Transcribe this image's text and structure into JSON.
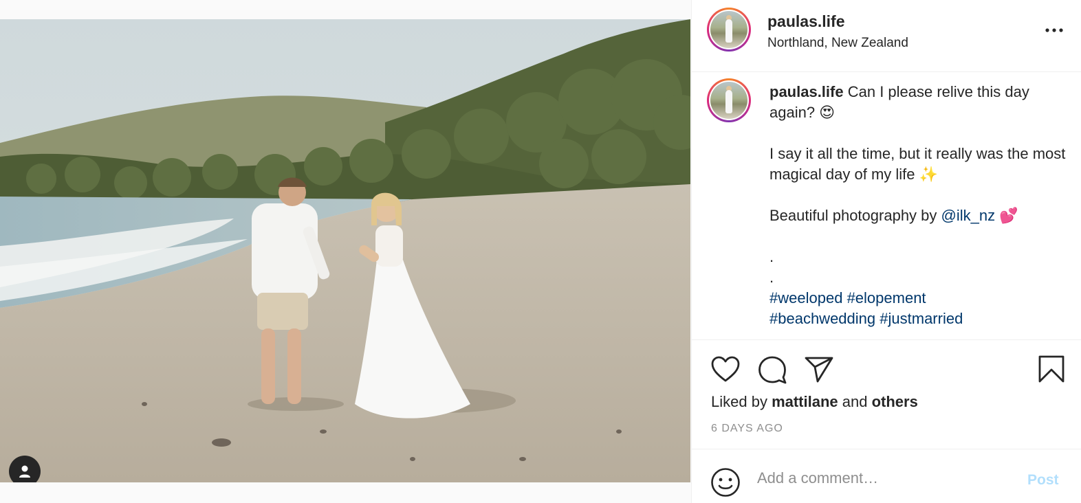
{
  "post": {
    "username": "paulas.life",
    "location": "Northland, New Zealand",
    "more_icon": "more-horizontal-icon"
  },
  "caption": {
    "username": "paulas.life",
    "line1": "Can I please relive this day again? 😍",
    "line2": "I say it all the time, but it really was the most magical day of my life ✨",
    "line3_prefix": "Beautiful photography by ",
    "mention": "@ilk_nz",
    "line3_suffix": " 💕",
    "dots": [
      ".",
      "."
    ],
    "hashtags_line1": [
      "#weeloped",
      "#elopement"
    ],
    "hashtags_line2": [
      "#beachwedding",
      "#justmarried"
    ]
  },
  "actions": {
    "liked_by_prefix": "Liked by ",
    "liked_by_user": "mattilane",
    "liked_by_and": " and ",
    "liked_by_others": "others",
    "timestamp": "6 DAYS AGO"
  },
  "comment": {
    "placeholder": "Add a comment…",
    "post_label": "Post"
  },
  "colors": {
    "link": "#00376b",
    "post_button_disabled": "#b2dffc",
    "muted": "#8e8e8e"
  }
}
